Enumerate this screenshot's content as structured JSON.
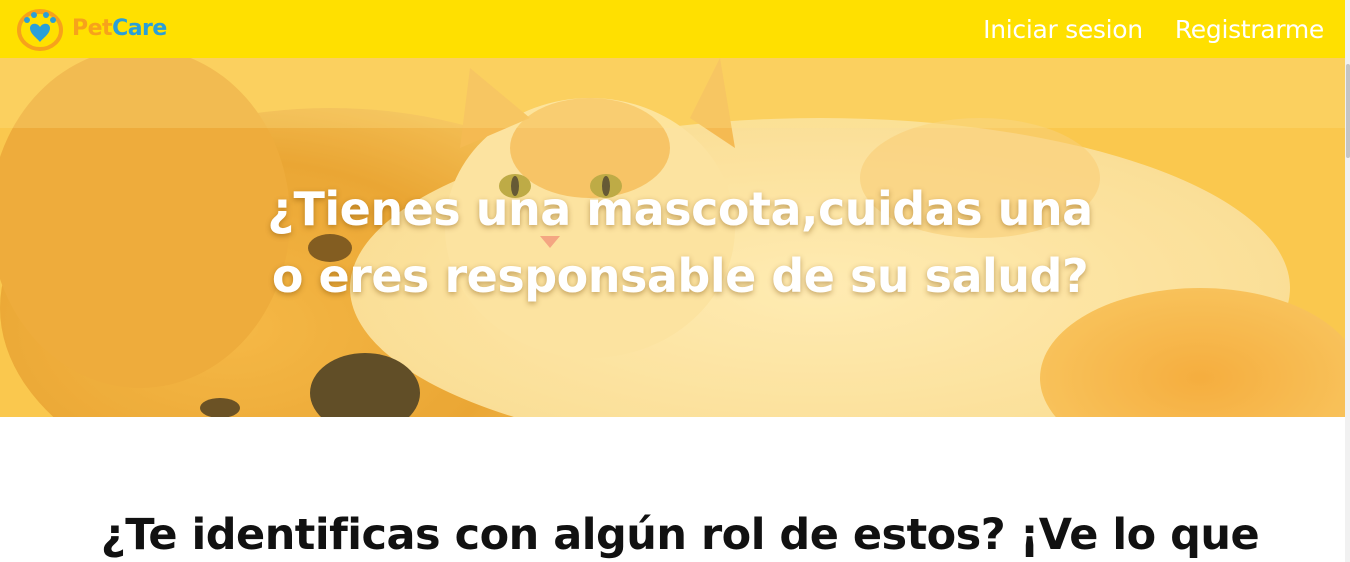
{
  "brand": {
    "name_part1": "Pet",
    "name_part2": "Care",
    "logo_icon": "paw-heart-logo-icon",
    "colors": {
      "pet": "#F7A21B",
      "care": "#2A9FD8"
    }
  },
  "nav": {
    "login_label": "Iniciar sesion",
    "register_label": "Registrarme"
  },
  "hero": {
    "title_line1": "¿Tienes una mascota,cuidas una",
    "title_line2": "o eres responsable de su salud?",
    "image": "dog-and-cat-photo"
  },
  "section": {
    "heading": "¿Te identificas con algún rol de estos? ¡Ve lo que"
  },
  "colors": {
    "navbar_bg": "#FFE000",
    "nav_text": "#FFFFFF",
    "hero_text": "#FFFFFF",
    "heading_text": "#111111"
  }
}
